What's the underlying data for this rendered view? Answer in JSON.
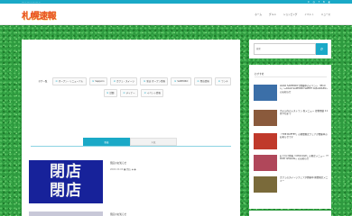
{
  "header": {
    "tagline": "── ─ ── ─ ── ── ─",
    "logo": "札幌速報",
    "social": [
      "X",
      "◎",
      "f",
      "N",
      "◐"
    ],
    "nav": [
      "ホーム",
      "グルメ",
      "ショッピング",
      "イベント",
      "ニュース"
    ]
  },
  "tags": [
    {
      "label": "タグ一覧",
      "icon": ""
    },
    {
      "label": "オープン・リニューアル",
      "icon": "⊙"
    },
    {
      "label": "Sapporo",
      "icon": "⊙"
    },
    {
      "label": "カフェ・スイーツ",
      "icon": "⊙"
    },
    {
      "label": "新店 オープン情報",
      "icon": "⊙"
    },
    {
      "label": "SAPPORO",
      "icon": "⊙"
    },
    {
      "label": "閉店情報",
      "icon": "⊙"
    },
    {
      "label": "ランチ",
      "icon": "⊙"
    },
    {
      "label": "話題",
      "icon": "⊙"
    },
    {
      "label": "ディナー",
      "icon": "⊙"
    },
    {
      "label": "イベント情報",
      "icon": "⊙"
    }
  ],
  "tabs": {
    "active": "新着",
    "inactive": "人気"
  },
  "post": {
    "thumb_line1": "閉店",
    "thumb_line2": "閉店",
    "title": "閉店のお知らせ",
    "meta": "20XX.XX.XX ■ 閉店 ◉ ●"
  },
  "post2": {
    "title": "閉店のお知らせ"
  },
  "search": {
    "placeholder": "検索",
    "button_icon": "search-icon"
  },
  "sidebar": {
    "title": "おすすめ",
    "items": [
      {
        "text": "AOAO SAPPOROで開催中のイベント「Photo」〜AOAO SAPPORO SWEET AQUARIUM〜 のお知らせ",
        "color": "#3b6fa8"
      },
      {
        "text": "ホテル内のレストラン 新メニュー 提供開始 11月下旬まで",
        "color": "#8a5a3c"
      },
      {
        "text": "「THE BUFFET」の期間限定フェアが開催中のお知らせです",
        "color": "#c0392b"
      },
      {
        "text": "おでかけ情報「CHOCOLE」の限定メニュー「TROIC Ishiwata」のお知らせ",
        "color": "#b0475a"
      },
      {
        "text": "カフェのスイーツフェアが開催中 期間限定メニュー",
        "color": "#7a6a3a"
      }
    ]
  }
}
